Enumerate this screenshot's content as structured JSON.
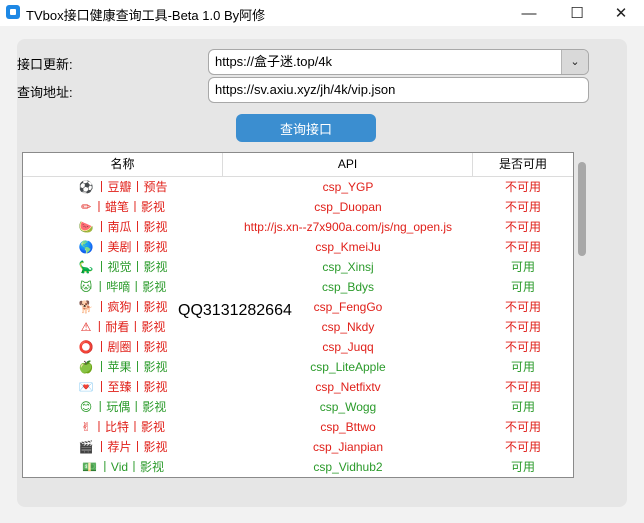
{
  "window": {
    "title": "TVbox接口健康查询工具-Beta 1.0 By阿修",
    "minimize_icon": "—",
    "maximize_icon": "☐",
    "close_icon": "✕"
  },
  "form": {
    "update_label": "接口更新:",
    "update_value": "https://盒子迷.top/4k",
    "dropdown_icon": "⌄",
    "address_label": "查询地址:",
    "address_value": "https://sv.axiu.xyz/jh/4k/vip.json",
    "query_button": "查询接口"
  },
  "table": {
    "headers": [
      "名称",
      "API",
      "是否可用"
    ],
    "rows": [
      {
        "icon": "⚽",
        "name": "丨豆瓣丨预告",
        "api": "csp_YGP",
        "status": "不可用",
        "ok": false
      },
      {
        "icon": "✏",
        "name": "丨蜡笔丨影视",
        "api": "csp_Duopan",
        "status": "不可用",
        "ok": false
      },
      {
        "icon": "🍉",
        "name": "丨南瓜丨影视",
        "api": "http://js.xn--z7x900a.com/js/ng_open.js",
        "status": "不可用",
        "ok": false
      },
      {
        "icon": "🌎",
        "name": "丨美剧丨影视",
        "api": "csp_KmeiJu",
        "status": "不可用",
        "ok": false
      },
      {
        "icon": "🦕",
        "name": "丨视觉丨影视",
        "api": "csp_Xinsj",
        "status": "可用",
        "ok": true
      },
      {
        "icon": "🐱",
        "name": "丨哔嘀丨影视",
        "api": "csp_Bdys",
        "status": "可用",
        "ok": true
      },
      {
        "icon": "🐕",
        "name": "丨疯狗丨影视",
        "api": "csp_FengGo",
        "status": "不可用",
        "ok": false
      },
      {
        "icon": "⚠",
        "name": "丨耐看丨影视",
        "api": "csp_Nkdy",
        "status": "不可用",
        "ok": false
      },
      {
        "icon": "⭕",
        "name": "丨剧圈丨影视",
        "api": "csp_Juqq",
        "status": "不可用",
        "ok": false
      },
      {
        "icon": "🍏",
        "name": "丨苹果丨影视",
        "api": "csp_LiteApple",
        "status": "可用",
        "ok": true
      },
      {
        "icon": "💌",
        "name": "丨至臻丨影视",
        "api": "csp_Netfixtv",
        "status": "不可用",
        "ok": false
      },
      {
        "icon": "😊",
        "name": "丨玩偶丨影视",
        "api": "csp_Wogg",
        "status": "可用",
        "ok": true
      },
      {
        "icon": "✌",
        "name": "丨比特丨影视",
        "api": "csp_Bttwo",
        "status": "不可用",
        "ok": false
      },
      {
        "icon": "🎬",
        "name": "丨荐片丨影视",
        "api": "csp_Jianpian",
        "status": "不可用",
        "ok": false
      },
      {
        "icon": "💵",
        "name": "丨Vid丨影视",
        "api": "csp_Vidhub2",
        "status": "可用",
        "ok": true
      }
    ]
  },
  "overlay_text": "QQ3131282664"
}
